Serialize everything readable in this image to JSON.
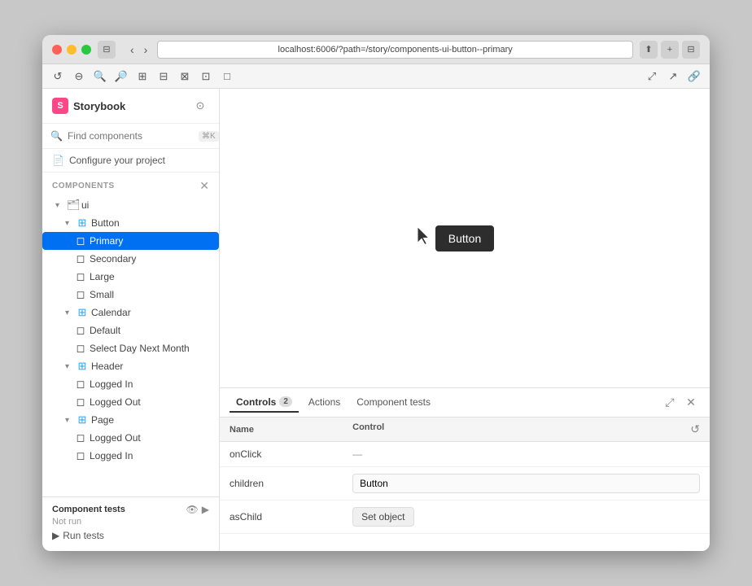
{
  "window": {
    "title": "localhost:6006/?path=/story/components-ui-button--primary"
  },
  "titlebar": {
    "traffic_lights": [
      "red",
      "yellow",
      "green"
    ],
    "back_btn": "‹",
    "forward_btn": "›",
    "address": "localhost:6006/?path=/story/components-ui-button--primary",
    "expand_icon": "⤢",
    "new_tab_icon": "+",
    "share_icon": "⬆"
  },
  "toolbar": {
    "refresh_btn": "↺",
    "zoom_out_btn": "−",
    "zoom_in_btn": "+",
    "zoom_reset_btn": "⊡",
    "grid_btn": "⊞",
    "grid2_btn": "⊟",
    "grid3_btn": "⊠",
    "grid4_btn": "⊡",
    "layout_btn": "□",
    "expand_btn": "⤢",
    "external_btn": "⬡",
    "link_btn": "🔗"
  },
  "sidebar": {
    "logo_text": "S",
    "title": "Storybook",
    "settings_icon": "⚙",
    "search": {
      "placeholder": "Find components",
      "shortcut": "⌘K",
      "add_icon": "+"
    },
    "configure": {
      "icon": "📄",
      "label": "Configure your project"
    },
    "components_section": {
      "label": "COMPONENTS",
      "close_icon": "✕"
    },
    "tree": [
      {
        "id": "ui",
        "label": "ui",
        "indent": 1,
        "type": "folder",
        "expanded": true,
        "chevron": "▾"
      },
      {
        "id": "button",
        "label": "Button",
        "indent": 2,
        "type": "component",
        "expanded": true,
        "chevron": "▾"
      },
      {
        "id": "primary",
        "label": "Primary",
        "indent": 3,
        "type": "story",
        "selected": true
      },
      {
        "id": "secondary",
        "label": "Secondary",
        "indent": 3,
        "type": "story"
      },
      {
        "id": "large",
        "label": "Large",
        "indent": 3,
        "type": "story"
      },
      {
        "id": "small",
        "label": "Small",
        "indent": 3,
        "type": "story"
      },
      {
        "id": "calendar",
        "label": "Calendar",
        "indent": 2,
        "type": "component",
        "expanded": true,
        "chevron": "▾"
      },
      {
        "id": "default",
        "label": "Default",
        "indent": 3,
        "type": "story"
      },
      {
        "id": "select-day",
        "label": "Select Day Next Month",
        "indent": 3,
        "type": "story"
      },
      {
        "id": "header",
        "label": "Header",
        "indent": 2,
        "type": "component",
        "expanded": true,
        "chevron": "▾"
      },
      {
        "id": "logged-in",
        "label": "Logged In",
        "indent": 3,
        "type": "story"
      },
      {
        "id": "logged-out",
        "label": "Logged Out",
        "indent": 3,
        "type": "story"
      },
      {
        "id": "page",
        "label": "Page",
        "indent": 2,
        "type": "component",
        "expanded": true,
        "chevron": "▾"
      },
      {
        "id": "page-logged-out",
        "label": "Logged Out",
        "indent": 3,
        "type": "story"
      },
      {
        "id": "page-logged-in",
        "label": "Logged In",
        "indent": 3,
        "type": "story"
      }
    ],
    "component_tests": {
      "title": "Component tests",
      "status": "Not run",
      "run_btn": "Run tests"
    }
  },
  "preview": {
    "button_label": "Button"
  },
  "controls": {
    "tabs": [
      {
        "id": "controls",
        "label": "Controls",
        "badge": "2",
        "active": true
      },
      {
        "id": "actions",
        "label": "Actions",
        "active": false
      },
      {
        "id": "component-tests",
        "label": "Component tests",
        "active": false
      }
    ],
    "expand_icon": "⤢",
    "close_icon": "✕",
    "reset_icon": "↺",
    "table": {
      "headers": [
        "Name",
        "Control"
      ],
      "rows": [
        {
          "name": "onClick",
          "control": "—",
          "type": "null"
        },
        {
          "name": "children",
          "control": "Button",
          "type": "text"
        },
        {
          "name": "asChild",
          "control": "Set object",
          "type": "button"
        }
      ]
    }
  }
}
